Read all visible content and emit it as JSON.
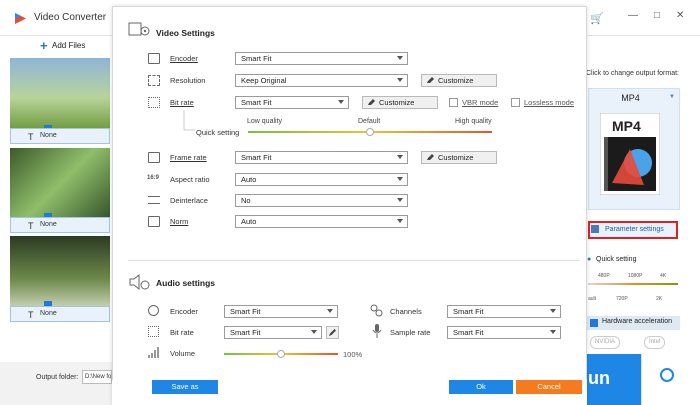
{
  "app": {
    "title": "Video Converter",
    "add_files": "Add Files"
  },
  "files": [
    {
      "label": "None"
    },
    {
      "label": "None"
    },
    {
      "label": "None"
    }
  ],
  "output": {
    "label": "Output folder:",
    "path": "D:\\New fo"
  },
  "right_panel": {
    "hint": "Click to change output format:",
    "format": "MP4",
    "format_icon_text": "MP4",
    "parameter_settings": "Parameter settings",
    "quick_setting": "Quick setting",
    "ticks_top": [
      "480P",
      "1080P",
      "4K"
    ],
    "ticks_bottom": [
      "ault",
      "720P",
      "2K"
    ],
    "hw_accel": "Hardware acceleration",
    "gpu": [
      "NVIDIA",
      "Intel"
    ],
    "run": "un"
  },
  "dialog": {
    "video_title": "Video Settings",
    "encoder": {
      "label": "Encoder",
      "value": "Smart Fit"
    },
    "resolution": {
      "label": "Resolution",
      "value": "Keep Original",
      "button": "Customize"
    },
    "bitrate": {
      "label": "Bit rate",
      "value": "Smart Fit",
      "button": "Customize",
      "vbr": "VBR mode",
      "lossless": "Lossless mode"
    },
    "quick_setting": {
      "label": "Quick setting",
      "low": "Low quality",
      "default": "Default",
      "high": "High quality",
      "value": 0.5
    },
    "framerate": {
      "label": "Frame rate",
      "value": "Smart Fit",
      "button": "Customize"
    },
    "aspect": {
      "label": "Aspect ratio",
      "value": "Auto"
    },
    "deinterlace": {
      "label": "Deinterlace",
      "value": "No"
    },
    "norm": {
      "label": "Norm",
      "value": "Auto"
    },
    "audio_title": "Audio settings",
    "a_encoder": {
      "label": "Encoder",
      "value": "Smart Fit"
    },
    "a_bitrate": {
      "label": "Bit rate",
      "value": "Smart Fit"
    },
    "volume": {
      "label": "Volume",
      "value": "100%",
      "level": 0.5
    },
    "channels": {
      "label": "Channels",
      "value": "Smart Fit"
    },
    "samplerate": {
      "label": "Sample rate",
      "value": "Smart Fit"
    },
    "save_as": "Save as",
    "ok": "Ok",
    "cancel": "Cancel"
  },
  "colors": {
    "accent": "#1e87e6",
    "cancel": "#f47b1e",
    "highlight": "#e02020"
  }
}
